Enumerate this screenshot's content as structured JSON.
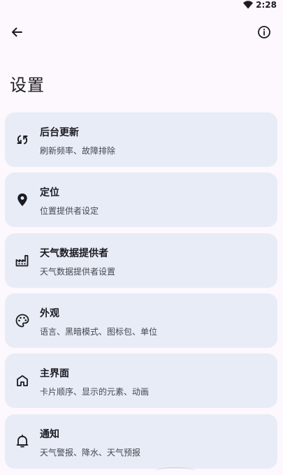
{
  "status_bar": {
    "time": "2:28"
  },
  "header": {
    "title": "设置"
  },
  "settings": [
    {
      "title": "后台更新",
      "subtitle": "刷新频率、故障排除",
      "icon": "sync-icon"
    },
    {
      "title": "定位",
      "subtitle": "位置提供者设定",
      "icon": "location-pin-icon"
    },
    {
      "title": "天气数据提供者",
      "subtitle": "天气数据提供者设置",
      "icon": "factory-icon"
    },
    {
      "title": "外观",
      "subtitle": "语言、黑暗模式、图标包、单位",
      "icon": "palette-icon"
    },
    {
      "title": "主界面",
      "subtitle": "卡片顺序、显示的元素、动画",
      "icon": "home-icon"
    },
    {
      "title": "通知",
      "subtitle": "天气警报、降水、天气预报",
      "icon": "bell-icon"
    }
  ]
}
